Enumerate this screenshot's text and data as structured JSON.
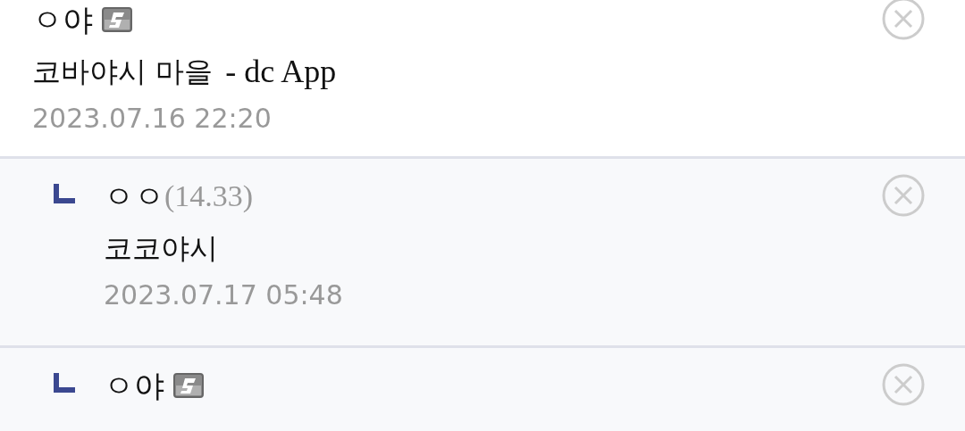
{
  "comments": [
    {
      "author": "ㅇ야",
      "fixed_nick": true,
      "content": "코바야시 마을",
      "signature": "- dc App",
      "date": "2023.07.16 22:20",
      "children": [
        {
          "author": "ㅇㅇ",
          "ip": "(14.33)",
          "fixed_nick": false,
          "content": "코코야시",
          "date": "2023.07.17 05:48"
        },
        {
          "author": "ㅇ야",
          "fixed_nick": true
        }
      ]
    }
  ]
}
